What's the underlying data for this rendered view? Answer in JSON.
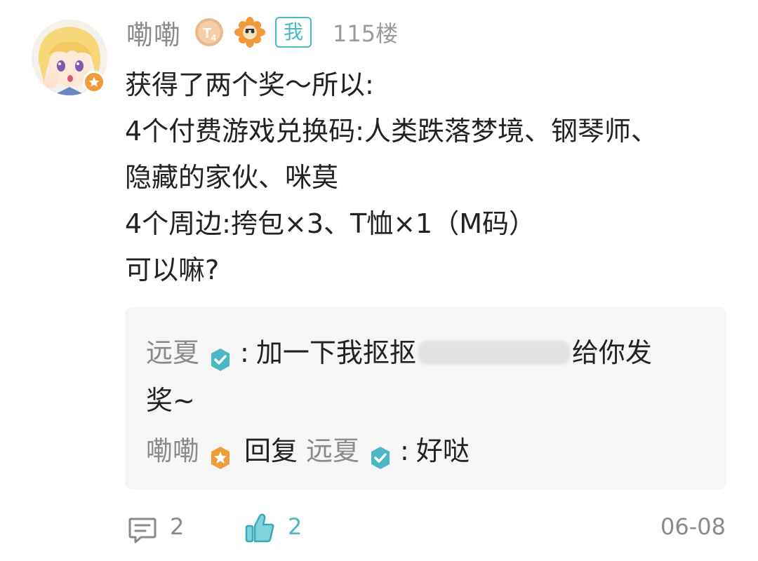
{
  "post": {
    "username": "嘞嘞",
    "me_tag": "我",
    "floor": "115楼",
    "content_lines": [
      "获得了两个奖～所以:",
      "4个付费游戏兑换码:人类跌落梦境、钢琴师、",
      "隐藏的家伙、咪莫",
      "4个周边:挎包×3、T恤×1（M码）",
      "可以嘛?"
    ]
  },
  "replies": {
    "first": {
      "author": "远夏",
      "sep": ":",
      "text_before": "加一下我抠抠",
      "text_after": "给你发",
      "text_wrap": "奖~"
    },
    "second": {
      "author": "嘞嘞",
      "reply_word": "回复",
      "target": "远夏",
      "sep": ":",
      "text": "好哒"
    }
  },
  "footer": {
    "comment_count": "2",
    "like_count": "2",
    "date": "06-08"
  },
  "icons": {
    "level_badge": "level-t4-icon",
    "flower_badge": "flower-badge-icon",
    "verified": "verified-check-icon",
    "star": "star-badge-icon",
    "comment": "comment-icon",
    "like": "thumbs-up-icon"
  },
  "colors": {
    "accent": "#4bb8c4",
    "star_badge": "#ef9d3a",
    "text_gray": "#8a8a8a"
  }
}
